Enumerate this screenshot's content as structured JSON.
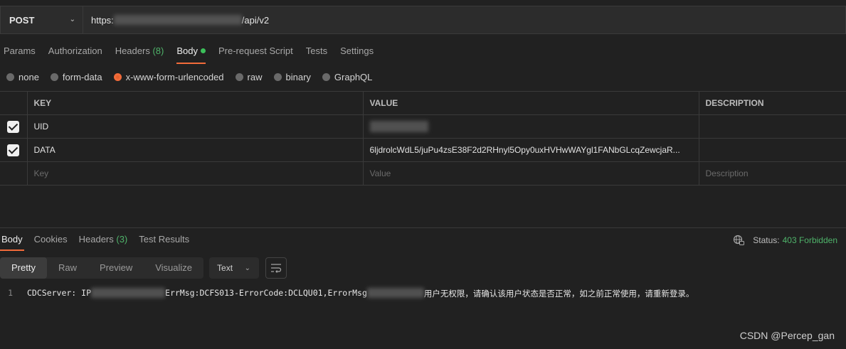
{
  "request": {
    "method": "POST",
    "url_prefix": "https:",
    "url_suffix": "/api/v2"
  },
  "request_tabs": [
    {
      "label": "Params"
    },
    {
      "label": "Authorization"
    },
    {
      "label": "Headers",
      "count": "(8)"
    },
    {
      "label": "Body"
    },
    {
      "label": "Pre-request Script"
    },
    {
      "label": "Tests"
    },
    {
      "label": "Settings"
    }
  ],
  "body_types": {
    "none": "none",
    "form_data": "form-data",
    "urlencoded": "x-www-form-urlencoded",
    "raw": "raw",
    "binary": "binary",
    "graphql": "GraphQL",
    "selected": "x-www-form-urlencoded"
  },
  "params_table": {
    "headers": {
      "key": "KEY",
      "value": "VALUE",
      "description": "DESCRIPTION"
    },
    "rows": [
      {
        "key": "UID",
        "value": "",
        "description": ""
      },
      {
        "key": "DATA",
        "value": "6ljdrolcWdL5/juPu4zsE38F2d2RHnyl5Opy0uxHVHwWAYgl1FANbGLcqZewcjaR...",
        "description": ""
      }
    ],
    "placeholders": {
      "key": "Key",
      "value": "Value",
      "description": "Description"
    }
  },
  "response_tabs": {
    "body": "Body",
    "cookies": "Cookies",
    "headers": "Headers",
    "headers_count": "(3)",
    "test_results": "Test Results"
  },
  "status": {
    "label": "Status:",
    "code": "403 Forbidden"
  },
  "view_modes": {
    "pretty": "Pretty",
    "raw": "Raw",
    "preview": "Preview",
    "visualize": "Visualize",
    "selected": "Pretty"
  },
  "format": {
    "selected": "Text"
  },
  "response_body": {
    "line_number": "1",
    "part1": "CDCServer: IP",
    "part2": "ErrMsg:DCFS013-ErrorCode:DCLQU01,ErrorMsg",
    "part3": "用户无权限，请确认该用户状态是否正常，如之前正常使用，请重新登录。"
  },
  "watermark": "CSDN @Percep_gan",
  "colors": {
    "accent": "#f26b3a",
    "success": "#4fb36a",
    "background": "#212121"
  }
}
